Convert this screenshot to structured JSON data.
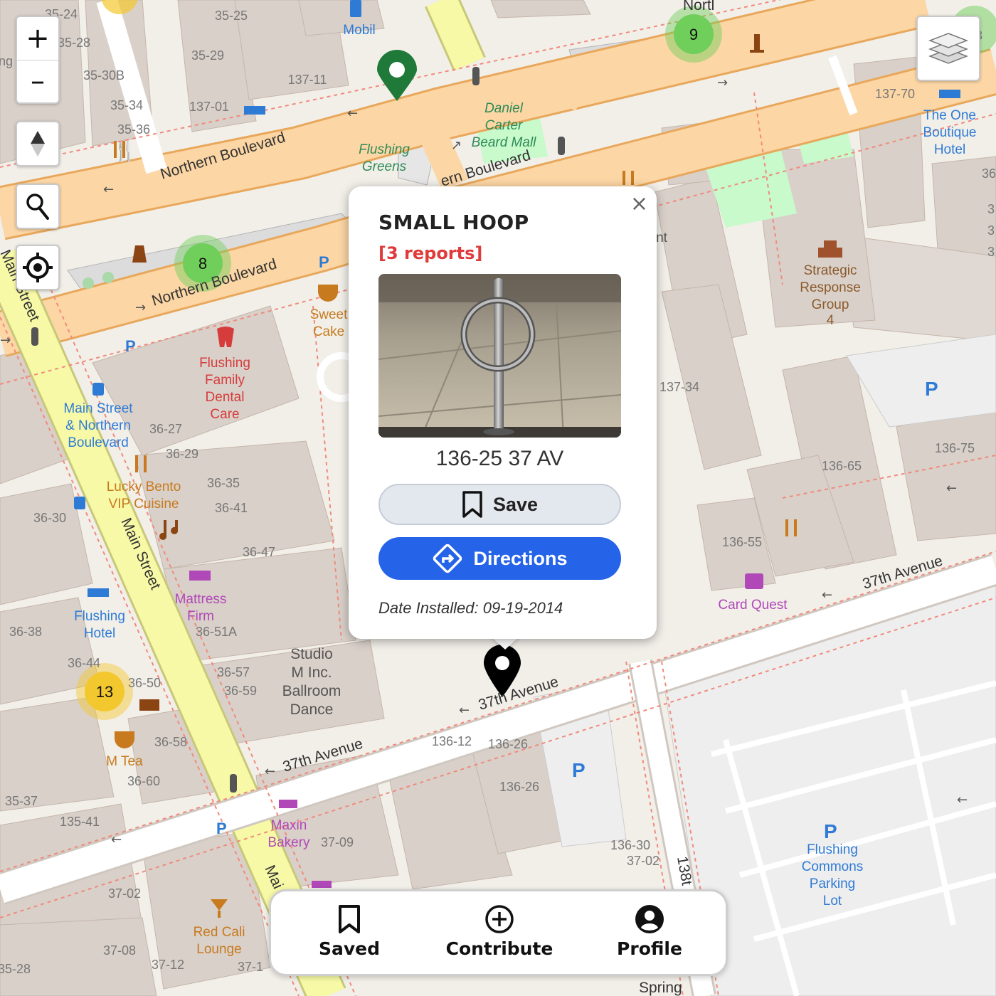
{
  "map": {
    "roads": {
      "northern_blvd_upper": "Northern Boulevard",
      "northern_blvd_right": "ern Boulevard",
      "northern_blvd_lower": "Northern Boulevard",
      "ave37_right": "37th Avenue",
      "ave37_mid": "37th Avenue",
      "ave37_left": "37th Avenue",
      "main_street": "Main Street",
      "main_street_top": "Main Street",
      "main_street_bottom": "Mai",
      "st138": "138t",
      "north_top": "Nortl",
      "spring": "Spring"
    },
    "pois": {
      "mobil": "Mobil",
      "flushing_greens": [
        "Flushing",
        "Greens"
      ],
      "daniel_carter": [
        "Daniel",
        "Carter",
        "Beard Mall"
      ],
      "one_boutique": [
        "The One",
        "Boutique",
        "Hotel"
      ],
      "strategic": [
        "Strategic",
        "Response",
        "Group",
        "4"
      ],
      "sweet_cake": [
        "Sweet",
        "Cake"
      ],
      "dental": [
        "Flushing",
        "Family",
        "Dental",
        "Care"
      ],
      "main_northern": [
        "Main Street",
        "& Northern",
        "Boulevard"
      ],
      "lucky_bento": [
        "Lucky Bento",
        "VIP Cuisine"
      ],
      "mattress": [
        "Mattress",
        "Firm"
      ],
      "flushing_hotel": [
        "Flushing",
        "Hotel"
      ],
      "studio": [
        "Studio",
        "M Inc.",
        "Ballroom",
        "Dance"
      ],
      "card_quest": "Card Quest",
      "m_tea": "M Tea",
      "maxin": [
        "Maxin",
        "Bakery"
      ],
      "red_cali": [
        "Red Cali",
        "Lounge"
      ],
      "commons": [
        "Flushing",
        "Commons",
        "Parking",
        "Lot"
      ],
      "nt": "nt"
    },
    "addresses": [
      "35-24",
      "35-25",
      "35-28",
      "35-29",
      "35-30B",
      "137-11",
      "35-34",
      "137-01",
      "35-36",
      "137-70",
      "36-27",
      "36-29",
      "36-35",
      "36-41",
      "36-30",
      "36-47",
      "36-51A",
      "36-38",
      "36-44",
      "36-50",
      "36-57",
      "36-59",
      "36-58",
      "36-60",
      "35-37",
      "135-41",
      "37-09",
      "136-12",
      "136-26",
      "136-26",
      "136-30",
      "37-02",
      "37-02",
      "37-08",
      "37-12",
      "35-28",
      "37-1",
      "137-34",
      "136-75",
      "136-65",
      "136-55",
      "3",
      "3",
      "3",
      "36",
      "ng",
      "3"
    ],
    "clusters": [
      {
        "count": "9",
        "color": "#6fcf5a"
      },
      {
        "count": "8",
        "color": "#6fcf5a"
      },
      {
        "count": "13",
        "color": "#f3c82e"
      }
    ],
    "parking_symbol": "P",
    "colors": {
      "road_major": "#fcd6a4",
      "road_major_edge": "#e8a85c",
      "road_yellow": "#f7f9a6",
      "building": "#d9d0c9",
      "park": "#c8facc",
      "poi_blue": "#2e7bd6",
      "poi_brown": "#a0522d",
      "poi_red": "#d63c3c",
      "poi_purple": "#b048b8",
      "green_pin": "#1f7a3a"
    }
  },
  "controls": {
    "zoom_in": "+",
    "zoom_out": "–"
  },
  "popup": {
    "close": "×",
    "title": "SMALL HOOP",
    "reports": "[3 reports]",
    "address": "136-25 37 AV",
    "save_label": "Save",
    "directions_label": "Directions",
    "date_installed": "Date Installed: 09-19-2014"
  },
  "nav": {
    "saved": "Saved",
    "contribute": "Contribute",
    "profile": "Profile"
  }
}
